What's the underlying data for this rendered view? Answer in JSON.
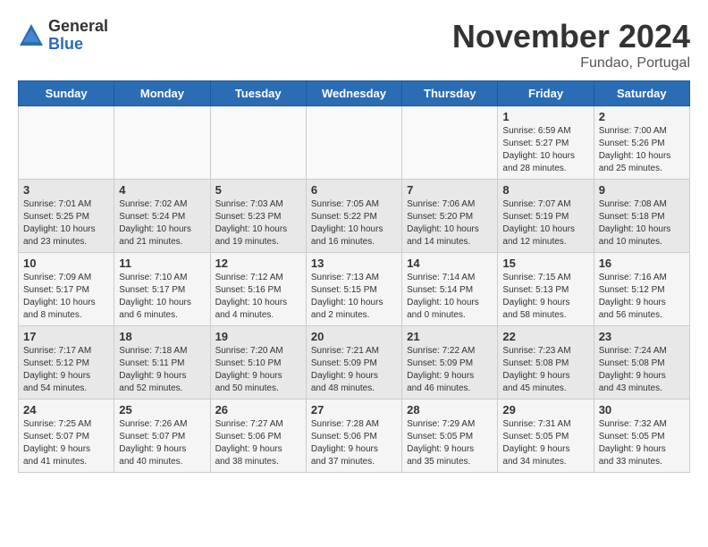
{
  "logo": {
    "general": "General",
    "blue": "Blue"
  },
  "title": "November 2024",
  "location": "Fundao, Portugal",
  "weekdays": [
    "Sunday",
    "Monday",
    "Tuesday",
    "Wednesday",
    "Thursday",
    "Friday",
    "Saturday"
  ],
  "weeks": [
    [
      {
        "day": "",
        "content": ""
      },
      {
        "day": "",
        "content": ""
      },
      {
        "day": "",
        "content": ""
      },
      {
        "day": "",
        "content": ""
      },
      {
        "day": "",
        "content": ""
      },
      {
        "day": "1",
        "content": "Sunrise: 6:59 AM\nSunset: 5:27 PM\nDaylight: 10 hours\nand 28 minutes."
      },
      {
        "day": "2",
        "content": "Sunrise: 7:00 AM\nSunset: 5:26 PM\nDaylight: 10 hours\nand 25 minutes."
      }
    ],
    [
      {
        "day": "3",
        "content": "Sunrise: 7:01 AM\nSunset: 5:25 PM\nDaylight: 10 hours\nand 23 minutes."
      },
      {
        "day": "4",
        "content": "Sunrise: 7:02 AM\nSunset: 5:24 PM\nDaylight: 10 hours\nand 21 minutes."
      },
      {
        "day": "5",
        "content": "Sunrise: 7:03 AM\nSunset: 5:23 PM\nDaylight: 10 hours\nand 19 minutes."
      },
      {
        "day": "6",
        "content": "Sunrise: 7:05 AM\nSunset: 5:22 PM\nDaylight: 10 hours\nand 16 minutes."
      },
      {
        "day": "7",
        "content": "Sunrise: 7:06 AM\nSunset: 5:20 PM\nDaylight: 10 hours\nand 14 minutes."
      },
      {
        "day": "8",
        "content": "Sunrise: 7:07 AM\nSunset: 5:19 PM\nDaylight: 10 hours\nand 12 minutes."
      },
      {
        "day": "9",
        "content": "Sunrise: 7:08 AM\nSunset: 5:18 PM\nDaylight: 10 hours\nand 10 minutes."
      }
    ],
    [
      {
        "day": "10",
        "content": "Sunrise: 7:09 AM\nSunset: 5:17 PM\nDaylight: 10 hours\nand 8 minutes."
      },
      {
        "day": "11",
        "content": "Sunrise: 7:10 AM\nSunset: 5:17 PM\nDaylight: 10 hours\nand 6 minutes."
      },
      {
        "day": "12",
        "content": "Sunrise: 7:12 AM\nSunset: 5:16 PM\nDaylight: 10 hours\nand 4 minutes."
      },
      {
        "day": "13",
        "content": "Sunrise: 7:13 AM\nSunset: 5:15 PM\nDaylight: 10 hours\nand 2 minutes."
      },
      {
        "day": "14",
        "content": "Sunrise: 7:14 AM\nSunset: 5:14 PM\nDaylight: 10 hours\nand 0 minutes."
      },
      {
        "day": "15",
        "content": "Sunrise: 7:15 AM\nSunset: 5:13 PM\nDaylight: 9 hours\nand 58 minutes."
      },
      {
        "day": "16",
        "content": "Sunrise: 7:16 AM\nSunset: 5:12 PM\nDaylight: 9 hours\nand 56 minutes."
      }
    ],
    [
      {
        "day": "17",
        "content": "Sunrise: 7:17 AM\nSunset: 5:12 PM\nDaylight: 9 hours\nand 54 minutes."
      },
      {
        "day": "18",
        "content": "Sunrise: 7:18 AM\nSunset: 5:11 PM\nDaylight: 9 hours\nand 52 minutes."
      },
      {
        "day": "19",
        "content": "Sunrise: 7:20 AM\nSunset: 5:10 PM\nDaylight: 9 hours\nand 50 minutes."
      },
      {
        "day": "20",
        "content": "Sunrise: 7:21 AM\nSunset: 5:09 PM\nDaylight: 9 hours\nand 48 minutes."
      },
      {
        "day": "21",
        "content": "Sunrise: 7:22 AM\nSunset: 5:09 PM\nDaylight: 9 hours\nand 46 minutes."
      },
      {
        "day": "22",
        "content": "Sunrise: 7:23 AM\nSunset: 5:08 PM\nDaylight: 9 hours\nand 45 minutes."
      },
      {
        "day": "23",
        "content": "Sunrise: 7:24 AM\nSunset: 5:08 PM\nDaylight: 9 hours\nand 43 minutes."
      }
    ],
    [
      {
        "day": "24",
        "content": "Sunrise: 7:25 AM\nSunset: 5:07 PM\nDaylight: 9 hours\nand 41 minutes."
      },
      {
        "day": "25",
        "content": "Sunrise: 7:26 AM\nSunset: 5:07 PM\nDaylight: 9 hours\nand 40 minutes."
      },
      {
        "day": "26",
        "content": "Sunrise: 7:27 AM\nSunset: 5:06 PM\nDaylight: 9 hours\nand 38 minutes."
      },
      {
        "day": "27",
        "content": "Sunrise: 7:28 AM\nSunset: 5:06 PM\nDaylight: 9 hours\nand 37 minutes."
      },
      {
        "day": "28",
        "content": "Sunrise: 7:29 AM\nSunset: 5:05 PM\nDaylight: 9 hours\nand 35 minutes."
      },
      {
        "day": "29",
        "content": "Sunrise: 7:31 AM\nSunset: 5:05 PM\nDaylight: 9 hours\nand 34 minutes."
      },
      {
        "day": "30",
        "content": "Sunrise: 7:32 AM\nSunset: 5:05 PM\nDaylight: 9 hours\nand 33 minutes."
      }
    ]
  ]
}
